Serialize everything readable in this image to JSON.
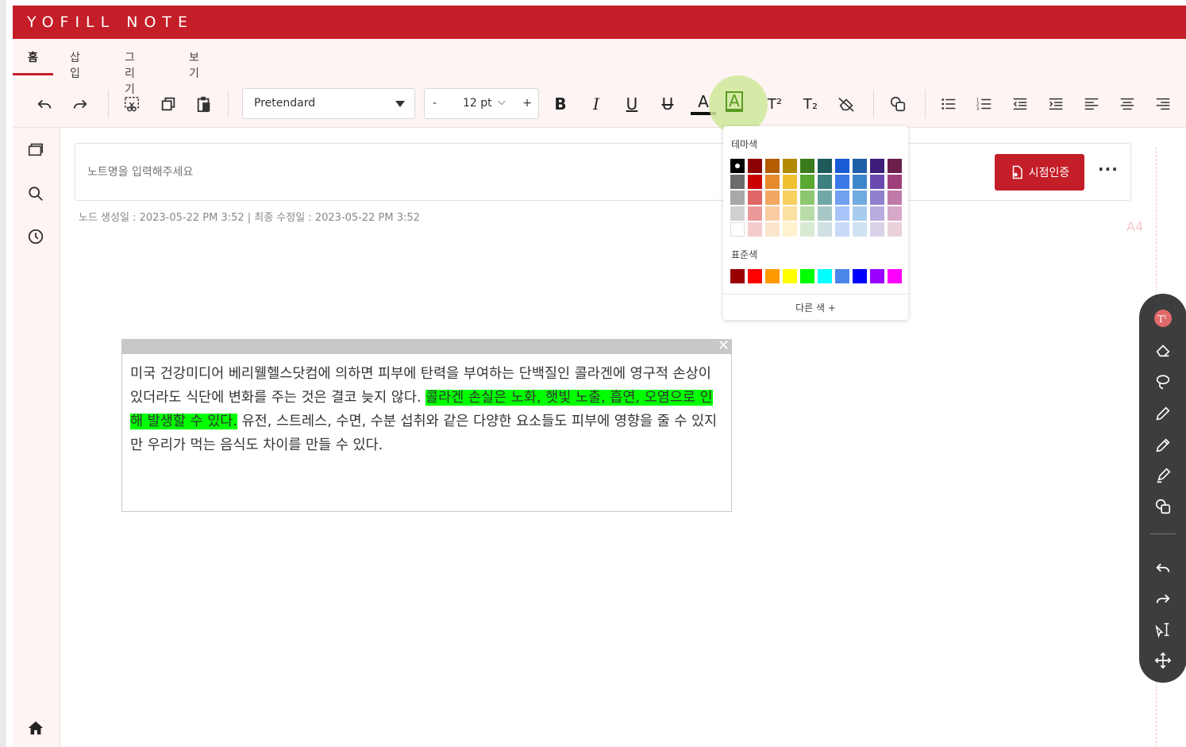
{
  "app": {
    "title": "YOFILL NOTE"
  },
  "tabs": [
    {
      "label": "홈",
      "active": true
    },
    {
      "label": "삽입",
      "active": false
    },
    {
      "label": "그리기",
      "active": false
    },
    {
      "label": "보기",
      "active": false
    }
  ],
  "toolbar": {
    "font_family": "Pretendard",
    "font_size_minus": "-",
    "font_size": "12 pt",
    "font_size_plus": "+",
    "bold": "B",
    "italic": "I",
    "underline": "U",
    "strike": "U",
    "font_color": "A",
    "highlight": "A",
    "superscript": "T²",
    "subscript": "T₂"
  },
  "note": {
    "title_placeholder": "노트명을 입력해주세요",
    "cert_button": "시점인증",
    "more": "···",
    "meta": "노드 생성일 : 2023-05-22 PM 3:52   |   최종 수정일 : 2023-05-22 PM 3:52",
    "page_size_label": "A4"
  },
  "textbox": {
    "text_before": "미국 건강미디어 베리웰헬스닷컴에 의하면 피부에 탄력을 부여하는 단백질인 콜라겐에 영구적 손상이 있더라도 식단에 변화를 주는 것은 결코 늦지 않다. ",
    "text_highlighted": "콜라겐 손실은 노화, 햇빛 노출, 흡연, 오염으로 인해 발생할 수 있다.",
    "text_after": " 유전, 스트레스, 수면, 수분 섭취와 같은 다양한 요소들도 피부에 영향을 줄 수 있지만 우리가 먹는 음식도 차이를 만들 수 있다.",
    "highlight_color": "#00ff00"
  },
  "palette": {
    "theme_label": "테마색",
    "standard_label": "표준색",
    "more_label": "다른 색 +",
    "theme_rows": [
      [
        "#000000",
        "#8b0000",
        "#b35c00",
        "#b38b00",
        "#3a7a1a",
        "#1f5a5a",
        "#1a5bd6",
        "#1e5fa8",
        "#3d1f7a",
        "#6b1f4a"
      ],
      [
        "#6b6b6b",
        "#cc0000",
        "#e68a2e",
        "#f0c030",
        "#5aa832",
        "#3d8080",
        "#3a7ae8",
        "#3d86cc",
        "#6a4ab0",
        "#a0407a"
      ],
      [
        "#a8a8a8",
        "#e06666",
        "#f0a860",
        "#f8d060",
        "#8cc870",
        "#70a8a8",
        "#70a0f0",
        "#70aae0",
        "#9080cc",
        "#c07aa8"
      ],
      [
        "#d0d0d0",
        "#ea9999",
        "#f8cca0",
        "#fce0a0",
        "#b8dca8",
        "#a8c8c8",
        "#a8c4f8",
        "#a8cceb",
        "#b8acdc",
        "#d8a8c8"
      ],
      [
        "#ffffff",
        "#f4cccc",
        "#fce5cd",
        "#fff2cc",
        "#d9ead3",
        "#d0e0e3",
        "#c9daf8",
        "#cfe2f3",
        "#d9d2e9",
        "#ead1dc"
      ]
    ],
    "standard": [
      "#990000",
      "#ff0000",
      "#ff9900",
      "#ffff00",
      "#00ff00",
      "#00ffff",
      "#4a86e8",
      "#0000ff",
      "#9900ff",
      "#ff00ff"
    ],
    "selected": "#000000"
  }
}
